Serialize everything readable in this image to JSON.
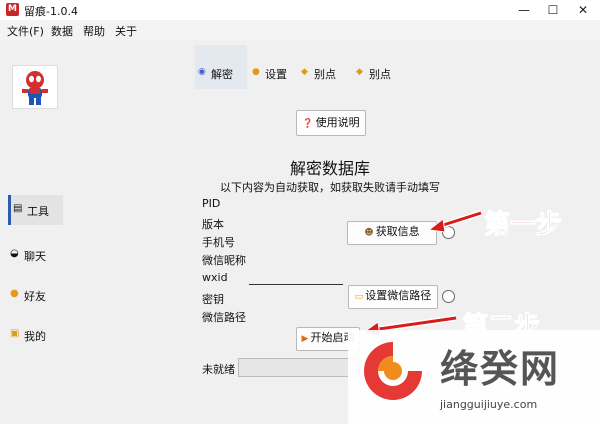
{
  "window": {
    "icon_letter": "M",
    "title": "留痕-1.0.4",
    "minimize": "—",
    "maximize": "☐",
    "close": "✕"
  },
  "menu": {
    "file": "文件(F)",
    "data": "数据",
    "help": "帮助",
    "about": "关于"
  },
  "sidebar": {
    "items": [
      {
        "label": "工具",
        "icon": "tool-icon"
      },
      {
        "label": "聊天",
        "icon": "chat-icon"
      },
      {
        "label": "好友",
        "icon": "friend-icon"
      },
      {
        "label": "我的",
        "icon": "profile-icon"
      }
    ]
  },
  "tabs": [
    {
      "label": "解密",
      "icon": "decrypt-icon"
    },
    {
      "label": "设置",
      "icon": "settings-icon"
    },
    {
      "label": "别点",
      "icon": "dont-click-icon"
    },
    {
      "label": "别点",
      "icon": "dont-click-icon"
    }
  ],
  "help_button": "使用说明",
  "section": {
    "title": "解密数据库",
    "subtitle": "以下内容为自动获取，如获取失败请手动填写"
  },
  "fields": {
    "pid": "PID",
    "version": "版本",
    "phone": "手机号",
    "nickname": "微信昵称",
    "wxid": "wxid",
    "key": "密钥",
    "path": "微信路径"
  },
  "buttons": {
    "get_info": "获取信息",
    "set_path": "设置微信路径",
    "start": "开始启动"
  },
  "status": "未就绪",
  "annotations": {
    "step1": "第一步",
    "step2": "第二步"
  },
  "watermark": {
    "name": "绛癸网",
    "url": "jiangguijiuye.com"
  },
  "colors": {
    "accent": "#2a5db0",
    "annotation": "#d81b1b",
    "watermark_orange": "#f28b1e",
    "watermark_red": "#e53935"
  }
}
